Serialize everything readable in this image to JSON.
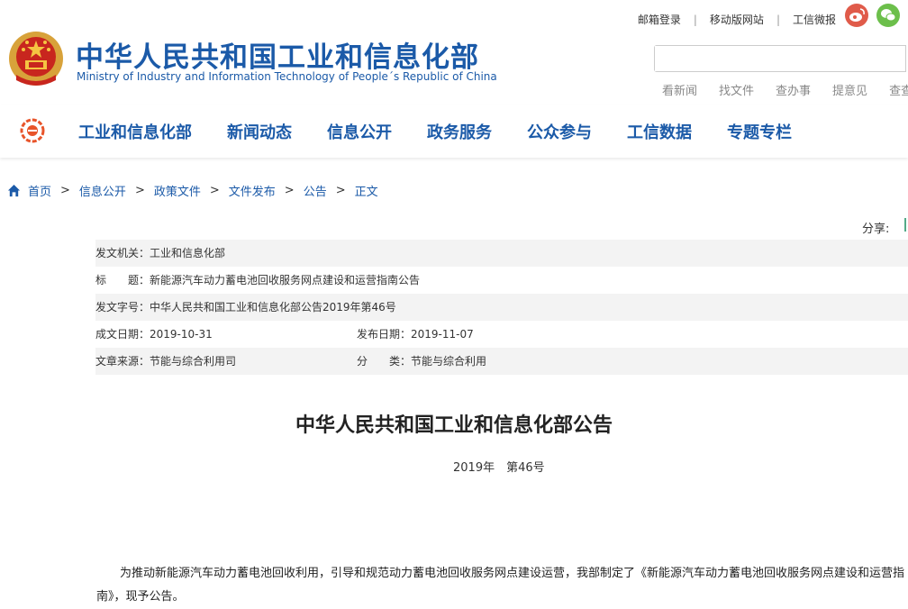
{
  "header": {
    "title": "中华人民共和国工业和信息化部",
    "subtitle": "Ministry of Industry and Information Technology of People´s Republic of China",
    "top_links": [
      "邮箱登录",
      "移动版网站",
      "工信微报"
    ],
    "quick_links": [
      "看新闻",
      "找文件",
      "查办事",
      "提意见",
      "查查"
    ]
  },
  "nav": {
    "items": [
      "工业和信息化部",
      "新闻动态",
      "信息公开",
      "政务服务",
      "公众参与",
      "工信数据",
      "专题专栏"
    ]
  },
  "breadcrumb": {
    "items": [
      "首页",
      "信息公开",
      "政策文件",
      "文件发布",
      "公告"
    ],
    "current": "正文",
    "separator": ">"
  },
  "share_label": "分享:",
  "meta": {
    "issuer_label": "发文机关：",
    "issuer": "工业和信息化部",
    "title_label": "标　　题：",
    "title": "新能源汽车动力蓄电池回收服务网点建设和运营指南公告",
    "doc_no_label": "发文字号：",
    "doc_no": "中华人民共和国工业和信息化部公告2019年第46号",
    "created_label": "成文日期：",
    "created": "2019-10-31",
    "published_label": "发布日期：",
    "published": "2019-11-07",
    "source_label": "文章来源：",
    "source": "节能与综合利用司",
    "category_label": "分　　类：",
    "category": "节能与综合利用"
  },
  "article": {
    "heading": "中华人民共和国工业和信息化部公告",
    "number": "2019年　第46号",
    "body": "为推动新能源汽车动力蓄电池回收利用，引导和规范动力蓄电池回收服务网点建设运营，我部制定了《新能源汽车动力蓄电池回收服务网点建设和运营指南》，现予公告。"
  },
  "colors": {
    "brand_blue": "#1b5aa8",
    "weibo_red": "#e05b4a",
    "wechat_green": "#6cbf4b",
    "meta_row_bg": "#f3f3f3"
  }
}
